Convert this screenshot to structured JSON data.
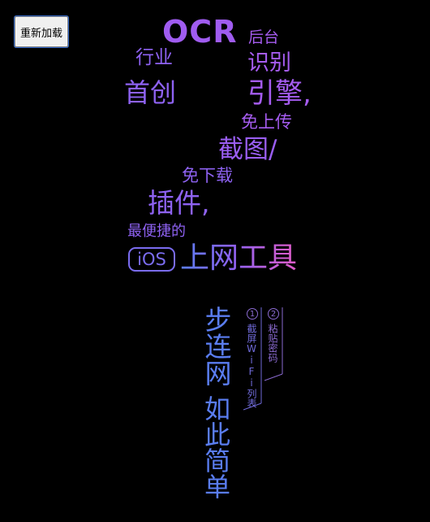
{
  "toolbar": {
    "reload_label": "重新加载"
  },
  "poster": {
    "ocr": "OCR",
    "backend": "后台",
    "industry": "行业",
    "recognition": "识别",
    "first": "首创",
    "engine": "引擎,",
    "no_upload": "免上传",
    "screenshot": "截图/",
    "no_download": "免下载",
    "plugin": "插件,",
    "most_convenient": "最便捷的",
    "ios": "iOS",
    "internet_tools": "上网工具",
    "wifi_steps": "步连网",
    "so_simple": "如此简单",
    "step1_num": "1",
    "step1_text": "截屏WiFi列表",
    "step2_num": "2",
    "step2_text": "粘贴密码"
  },
  "colors": {
    "background": "#000000",
    "purple": "#a55cf0",
    "violet": "#8e62f2",
    "blue": "#5a7df0",
    "pink": "#e05cc8"
  }
}
